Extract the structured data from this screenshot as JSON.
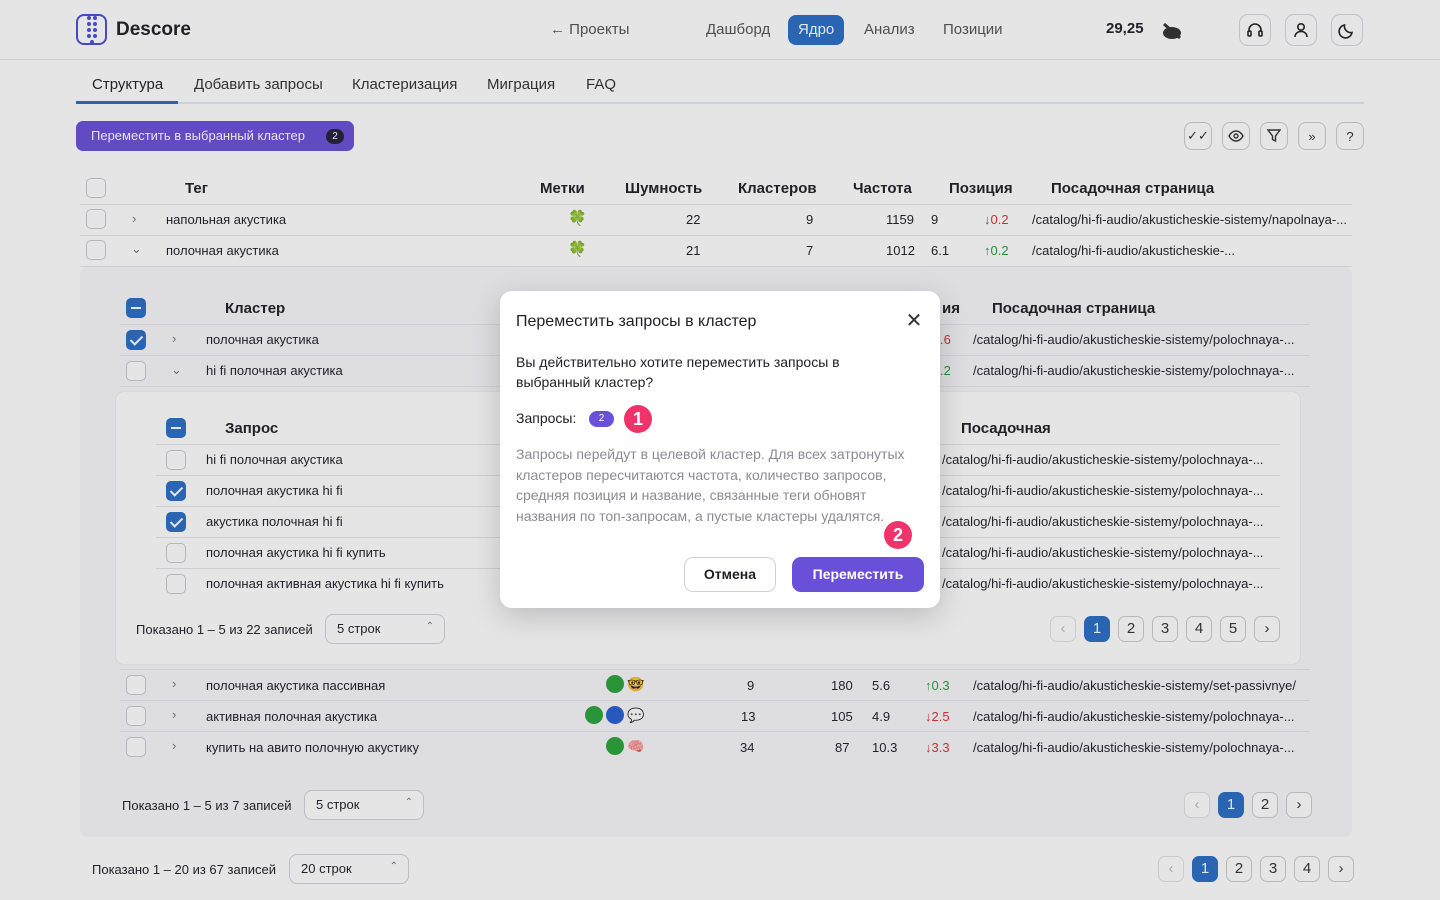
{
  "header": {
    "logo_text": "Descore",
    "back_label": "← Проекты",
    "nav": [
      "Дашборд",
      "Ядро",
      "Анализ",
      "Позиции"
    ],
    "balance": "29,25"
  },
  "tabs": [
    "Структура",
    "Добавить запросы",
    "Кластеризация",
    "Миграция",
    "FAQ"
  ],
  "move_button": {
    "label": "Переместить в выбранный кластер",
    "count": "2"
  },
  "tag_table": {
    "headers": [
      "Тег",
      "Метки",
      "Шумность",
      "Кластеров",
      "Частота",
      "Позиция",
      "Посадочная страница"
    ],
    "rows": [
      {
        "name": "напольная акустика",
        "noise": "22",
        "clusters": "9",
        "freq": "1159",
        "pos": "9",
        "delta": "↓0.2",
        "page": "/catalog/hi-fi-audio/akusticheskie-sistemy/napolnaya-..."
      },
      {
        "name": "полочная акустика",
        "noise": "21",
        "clusters": "7",
        "freq": "1012",
        "pos": "6.1",
        "delta": "↑0.2",
        "page": "/catalog/hi-fi-audio/akusticheskie-..."
      }
    ]
  },
  "cluster_table": {
    "headers": [
      "Кластер",
      "ия",
      "Посадочная страница"
    ],
    "rows": [
      {
        "name": "полочная акустика",
        "delta": ".6",
        "page": "/catalog/hi-fi-audio/akusticheskie-sistemy/polochnaya-..."
      },
      {
        "name": "hi fi полочная акустика",
        "delta": ".2",
        "page": "/catalog/hi-fi-audio/akusticheskie-sistemy/polochnaya-..."
      }
    ],
    "more_rows": [
      {
        "name": "полочная акустика пассивная",
        "noise": "9",
        "freq": "180",
        "pos": "5.6",
        "delta": "↑0.3",
        "page": "/catalog/hi-fi-audio/akusticheskie-sistemy/set-passivnye/"
      },
      {
        "name": "активная полочная акустика",
        "noise": "13",
        "freq": "105",
        "pos": "4.9",
        "delta": "↓2.5",
        "page": "/catalog/hi-fi-audio/akusticheskie-sistemy/polochnaya-..."
      },
      {
        "name": "купить на авито полочную акустику",
        "noise": "34",
        "freq": "87",
        "pos": "10.3",
        "delta": "↓3.3",
        "page": "/catalog/hi-fi-audio/akusticheskie-sistemy/polochnaya-..."
      }
    ],
    "footer_text": "Показано 1 – 5 из 7 записей",
    "rows_select": "5 строк",
    "pages": [
      "1",
      "2"
    ]
  },
  "query_table": {
    "headers": [
      "Запрос",
      "Посадочная"
    ],
    "rows": [
      {
        "name": "hi fi полочная акустика",
        "page": "/catalog/hi-fi-audio/akusticheskie-sistemy/polochnaya-..."
      },
      {
        "name": "полочная акустика hi fi",
        "page": "/catalog/hi-fi-audio/akusticheskie-sistemy/polochnaya-..."
      },
      {
        "name": "акустика полочная hi fi",
        "page": "/catalog/hi-fi-audio/akusticheskie-sistemy/polochnaya-..."
      },
      {
        "name": "полочная акустика hi fi купить",
        "page": "/catalog/hi-fi-audio/akusticheskie-sistemy/polochnaya-..."
      },
      {
        "name": "полочная активная акустика hi fi купить",
        "page": "/catalog/hi-fi-audio/akusticheskie-sistemy/polochnaya-..."
      }
    ],
    "footer_text": "Показано 1 – 5 из 22 записей",
    "rows_select": "5 строк",
    "pages": [
      "1",
      "2",
      "3",
      "4",
      "5"
    ]
  },
  "main_footer": {
    "text": "Показано 1 – 20 из 67 записей",
    "rows_select": "20 строк",
    "pages": [
      "1",
      "2",
      "3",
      "4"
    ]
  },
  "modal": {
    "title": "Переместить запросы в кластер",
    "question": "Вы действительно хотите переместить запросы в выбранный кластер?",
    "label": "Запросы:",
    "count": "2",
    "note": "Запросы перейдут в целевой кластер. Для всех затронутых кластеров пересчитаются частота, количество запросов, средняя позиция и название, связанные теги обновят названия по топ-запросам, а пустые кластеры удалятся.",
    "cancel": "Отмена",
    "confirm": "Переместить"
  },
  "markers": [
    "1",
    "2"
  ],
  "colors": {
    "accent": "#6a4fd8",
    "primary": "#2a6ec4",
    "marker": "#f0346b"
  }
}
